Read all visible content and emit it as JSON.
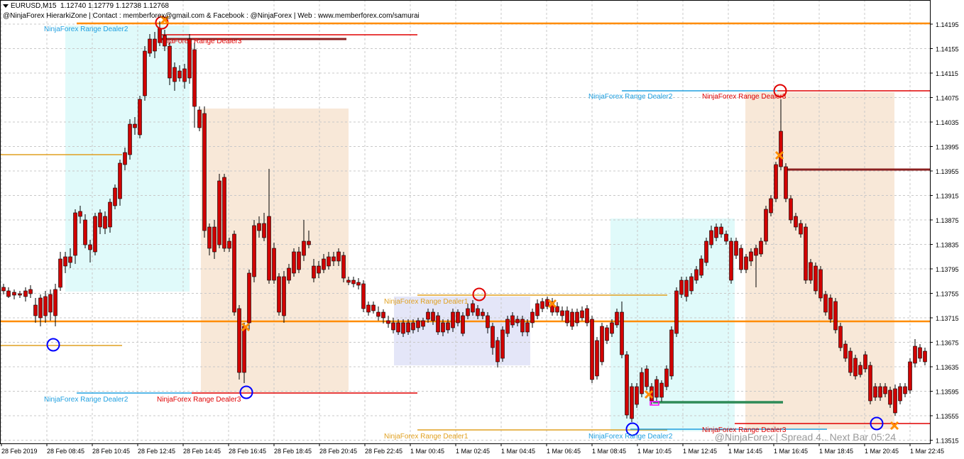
{
  "header": {
    "symbol": "EURUSD,M15",
    "ohlc": "1.12740 1.12779 1.12738 1.12768",
    "info": "@NinjaForex HierarkiZone | Contact : memberforex@gmail.com & Facebook : @NinjaForex | Web : www.memberforex.com/samurai"
  },
  "watermark": "@NinjaForex | Spread 4.. Next Bar 05:24",
  "colors": {
    "background": "#ffffff",
    "grid": "#c8c8c8",
    "bull": "#1f7a1f",
    "bear": "#d00000",
    "dealer1": "#e0a020",
    "dealer2": "#20a0e0",
    "dealer3": "#e00000",
    "midline": "#ff8c00",
    "zone_cyan": "#e0fafa",
    "zone_peach": "#f8e8d8",
    "zone_lavender": "#e4e6f8"
  },
  "price_axis": {
    "labels": [
      "1.14195",
      "1.14155",
      "1.14115",
      "1.14075",
      "1.14035",
      "1.13995",
      "1.13955",
      "1.13915",
      "1.13875",
      "1.13835",
      "1.13795",
      "1.13755",
      "1.13715",
      "1.13675",
      "1.13635",
      "1.13595",
      "1.13555",
      "1.13515"
    ]
  },
  "time_axis": {
    "labels": [
      "28 Feb 2019",
      "28 Feb 08:45",
      "28 Feb 10:45",
      "28 Feb 12:45",
      "28 Feb 14:45",
      "28 Feb 16:45",
      "28 Feb 18:45",
      "28 Feb 20:45",
      "28 Feb 22:45",
      "1 Mar 00:45",
      "1 Mar 02:45",
      "1 Mar 04:45",
      "1 Mar 06:45",
      "1 Mar 08:45",
      "1 Mar 10:45",
      "1 Mar 12:45",
      "1 Mar 14:45",
      "1 Mar 16:45",
      "1 Mar 18:45",
      "1 Mar 20:45",
      "1 Mar 22:45"
    ]
  },
  "level_labels": {
    "d2_top_left": "NinjaForex Range Dealer2",
    "d3_top_left": "NinjaForex Range Dealer3",
    "d2_mid_right": "NinjaForex Range Dealer2",
    "d3_mid_right": "NinjaForex Range Dealer3",
    "d1_mid": "NinjaForex Range Dealer1",
    "d2_bottom_left": "NinjaForex Range Dealer2",
    "d3_bottom_left": "NinjaForex Range Dealer3",
    "d1_bottom_mid": "NinjaForex Range Dealer1",
    "d2_bottom_mid": "NinjaForex Range Dealer2",
    "d3_bottom_right": "NinjaForex Range Dealer3"
  },
  "current_price": "1.13715"
}
